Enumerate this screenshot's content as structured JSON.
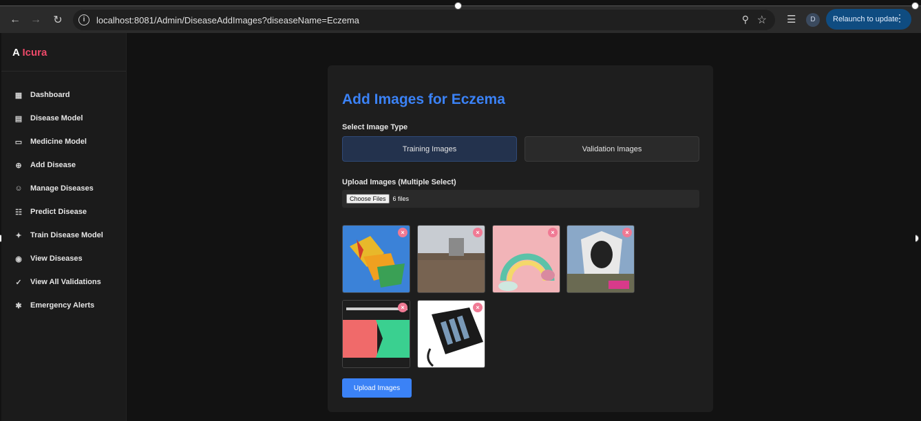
{
  "browser": {
    "url": "localhost:8081/Admin/DiseaseAddImages?diseaseName=Eczema",
    "profile_initial": "D",
    "relaunch_label": "Relaunch to update"
  },
  "sidebar": {
    "brand_prefix": "A",
    "brand_name": "Icura",
    "items": [
      {
        "label": "Dashboard",
        "icon": "dashboard-icon"
      },
      {
        "label": "Disease Model",
        "icon": "table-icon"
      },
      {
        "label": "Medicine Model",
        "icon": "clipboard-icon"
      },
      {
        "label": "Add Disease",
        "icon": "plus-circle-icon"
      },
      {
        "label": "Manage Diseases",
        "icon": "users-gear-icon"
      },
      {
        "label": "Predict Disease",
        "icon": "report-icon"
      },
      {
        "label": "Train Disease Model",
        "icon": "brain-icon"
      },
      {
        "label": "View Diseases",
        "icon": "eye-icon"
      },
      {
        "label": "View All Validations",
        "icon": "checklist-icon"
      },
      {
        "label": "Emergency Alerts",
        "icon": "asterisk-icon"
      }
    ]
  },
  "form": {
    "title": "Add Images for Eczema",
    "image_type_label": "Select Image Type",
    "training_label": "Training Images",
    "validation_label": "Validation Images",
    "selected_type": "Training Images",
    "upload_label": "Upload Images (Multiple Select)",
    "choose_files_label": "Choose Files",
    "files_count": "6 files",
    "upload_button": "Upload Images",
    "remove_glyph": "×"
  },
  "colors": {
    "accent": "#3b82f6",
    "brand_pink": "#ee4a6a",
    "remove_badge": "#f07a94"
  }
}
